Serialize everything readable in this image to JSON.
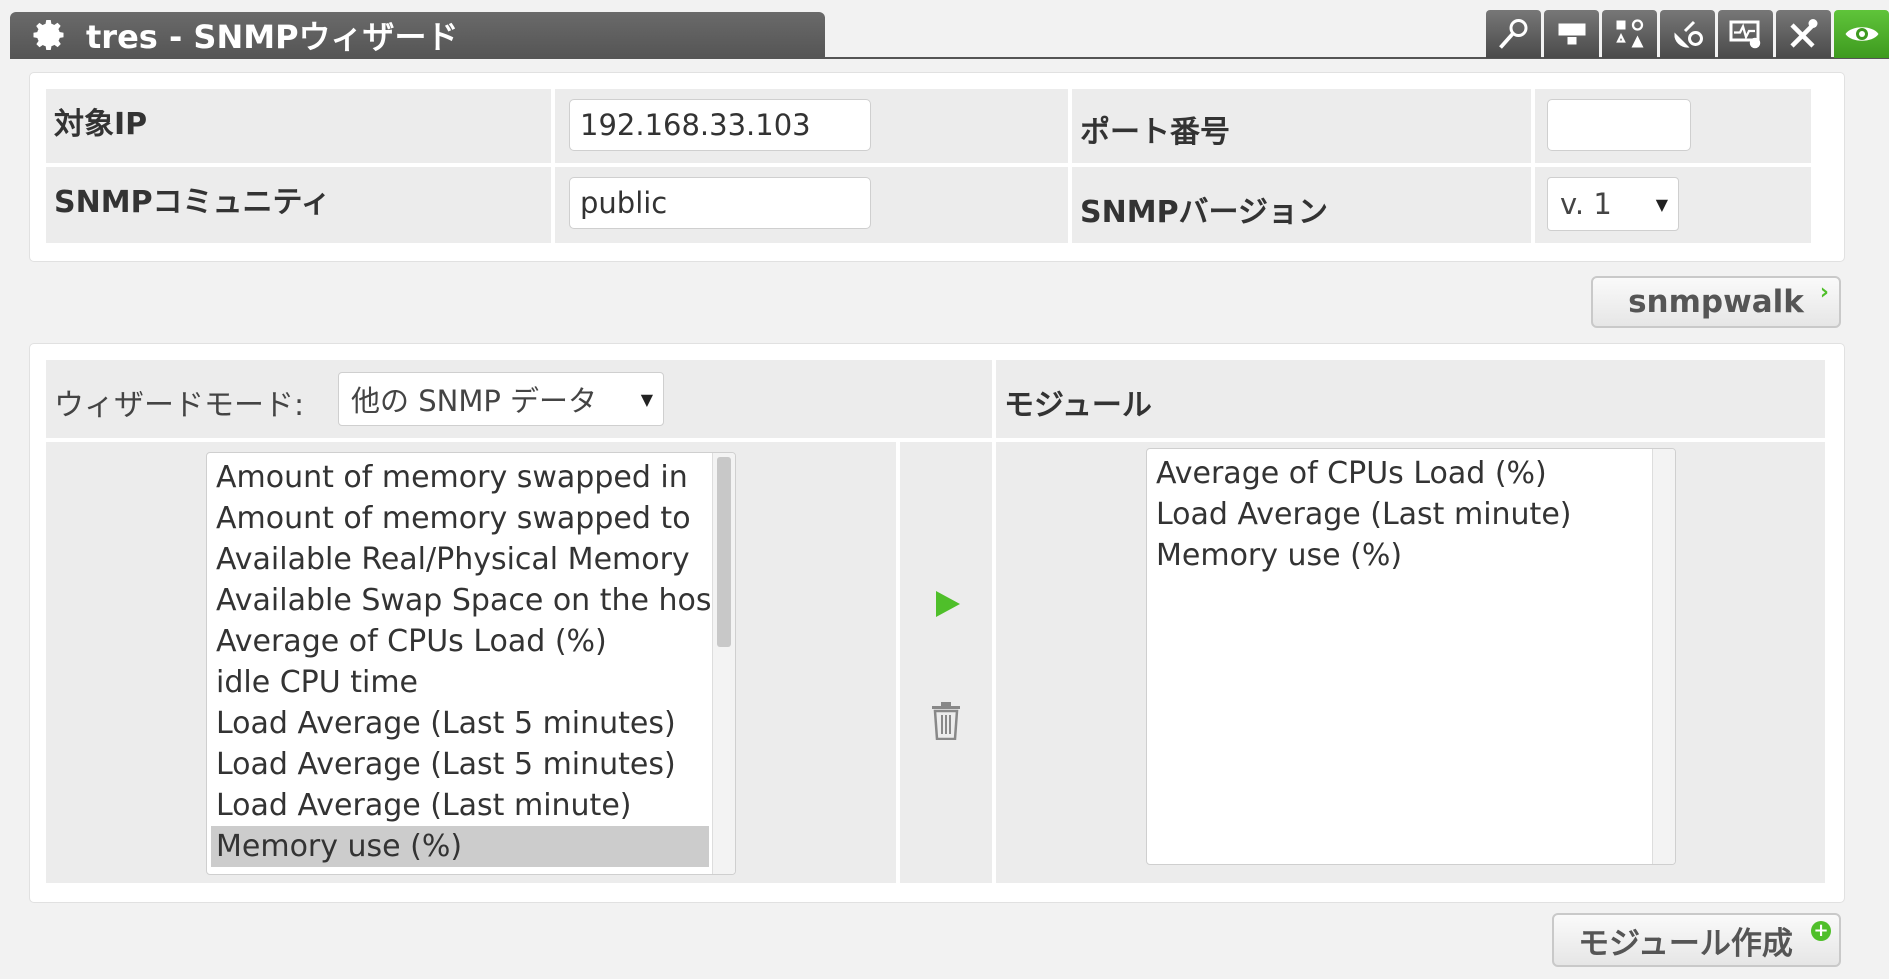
{
  "header": {
    "title": "tres - SNMPウィザード"
  },
  "toolbar": {
    "icons": [
      "magnifier-icon",
      "monitor-icon",
      "network-map-icon",
      "satellite-icon",
      "agent-config-icon",
      "tools-icon",
      "eye-icon"
    ]
  },
  "form": {
    "target_ip_label": "対象IP",
    "target_ip_value": "192.168.33.103",
    "port_label": "ポート番号",
    "port_value": "",
    "community_label": "SNMPコミュニティ",
    "community_value": "public",
    "version_label": "SNMPバージョン",
    "version_value": "v. 1"
  },
  "snmpwalk_label": "snmpwalk",
  "wizard": {
    "mode_label": "ウィザードモード:",
    "mode_value": "他の SNMP データ",
    "modules_header": "モジュール",
    "available": [
      "Amount of memory swapped in",
      "Amount of memory swapped to",
      "Available Real/Physical Memory",
      "Available Swap Space on the host",
      "Average of CPUs Load (%)",
      "idle CPU time",
      "Load Average (Last 5 minutes)",
      "Load Average (Last 5 minutes)",
      "Load Average (Last minute)",
      "Memory use (%)"
    ],
    "selected_index": 9,
    "modules": [
      "Average of CPUs Load (%)",
      "Load Average (Last minute)",
      "Memory use (%)"
    ]
  },
  "create_module_label": "モジュール作成",
  "colors": {
    "accent_green": "#4fbf2a",
    "header_gray": "#5a5a5a"
  }
}
